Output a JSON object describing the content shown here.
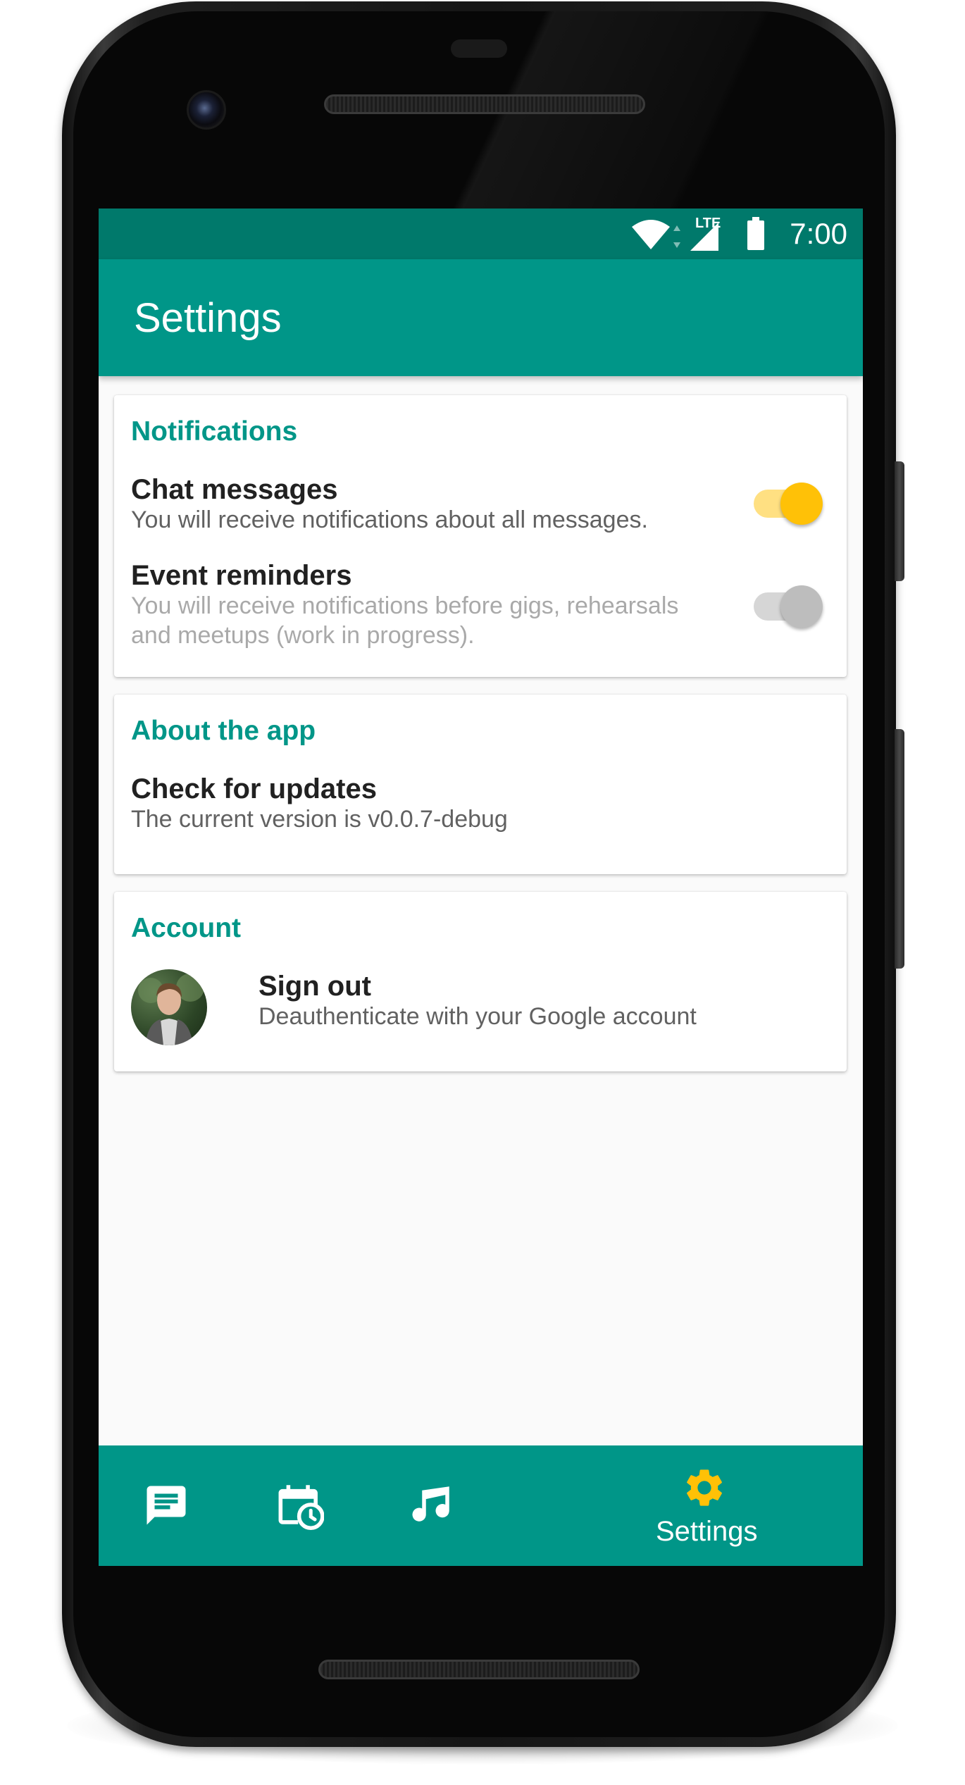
{
  "status_bar": {
    "time": "7:00",
    "network_label": "LTE",
    "icons": [
      "wifi-icon",
      "signal-icon",
      "battery-icon"
    ]
  },
  "app_bar": {
    "title": "Settings"
  },
  "sections": {
    "notifications": {
      "title": "Notifications",
      "chat": {
        "title": "Chat messages",
        "summary": "You will receive notifications about all messages.",
        "enabled": true
      },
      "events": {
        "title": "Event reminders",
        "summary_line1": "You will receive notifications before gigs, rehearsals",
        "summary_line2": "and meetups (work in progress).",
        "enabled": false
      }
    },
    "about": {
      "title": "About the app",
      "updates": {
        "title": "Check for updates",
        "summary": "The current version is v0.0.7-debug"
      }
    },
    "account": {
      "title": "Account",
      "signout": {
        "title": "Sign out",
        "summary": "Deauthenticate with your Google account"
      }
    }
  },
  "bottom_nav": {
    "items": [
      {
        "icon": "chat-icon"
      },
      {
        "icon": "calendar-clock-icon"
      },
      {
        "icon": "music-note-icon"
      },
      {
        "icon": "gear-icon",
        "label": "Settings",
        "active": true
      }
    ]
  },
  "colors": {
    "primary": "#009688",
    "primary_dark": "#00796b",
    "accent": "#ffc107",
    "background": "#fafafa"
  }
}
